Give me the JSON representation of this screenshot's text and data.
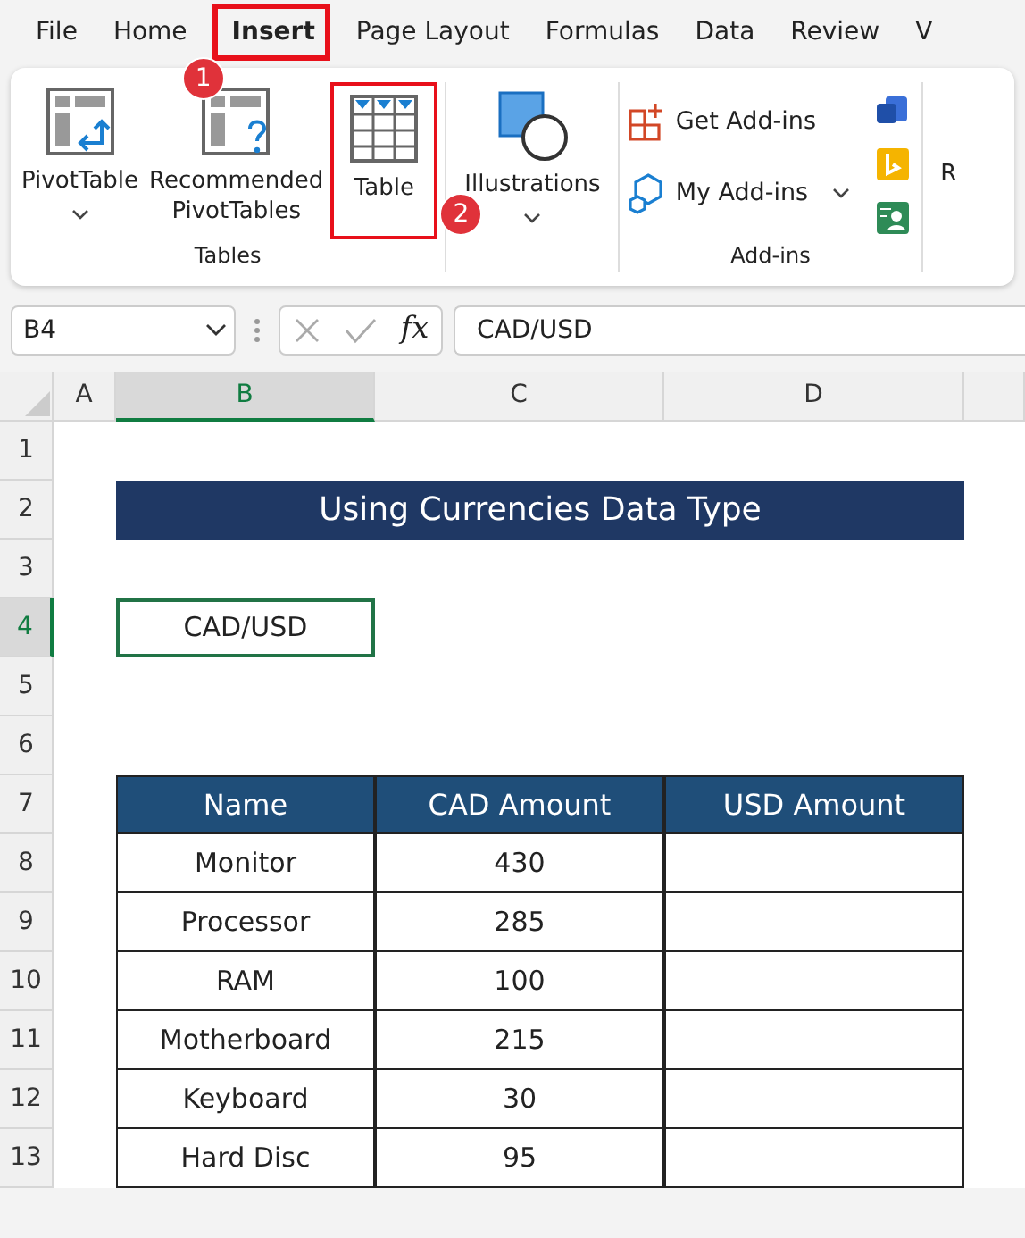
{
  "ribbon_tabs": [
    {
      "label": "File",
      "selected": false
    },
    {
      "label": "Home",
      "selected": false
    },
    {
      "label": "Insert",
      "selected": true,
      "step": "1"
    },
    {
      "label": "Page Layout",
      "selected": false
    },
    {
      "label": "Formulas",
      "selected": false
    },
    {
      "label": "Data",
      "selected": false
    },
    {
      "label": "Review",
      "selected": false
    },
    {
      "label": "V",
      "selected": false
    }
  ],
  "ribbon_groups": [
    {
      "label": "Tables",
      "items": [
        {
          "kind": "pivot",
          "label": "PivotTable",
          "dropdown": true
        },
        {
          "kind": "recommended",
          "label": "Recommended PivotTables"
        },
        {
          "kind": "table",
          "label": "Table",
          "step": "2"
        }
      ]
    },
    {
      "items": [
        {
          "kind": "shapes",
          "label": "Illustrations",
          "dropdown": true
        }
      ]
    },
    {
      "label": "Add-ins",
      "items": [
        {
          "kind": "get-addins",
          "label": "Get Add-ins"
        },
        {
          "kind": "my-addins",
          "label": "My Add-ins",
          "dropdown": true
        }
      ]
    },
    {
      "items": [
        {
          "kind": "partial",
          "label": "R"
        }
      ]
    }
  ],
  "formula_bar": {
    "name_box": "B4",
    "function_label": "fx",
    "formula": "CAD/USD"
  },
  "sheet": {
    "columns": [
      {
        "label": "A",
        "selected": false
      },
      {
        "label": "B",
        "selected": true
      },
      {
        "label": "C",
        "selected": false
      },
      {
        "label": "D",
        "selected": false
      }
    ],
    "rows": [
      {
        "label": "1",
        "selected": false
      },
      {
        "label": "2",
        "selected": false
      },
      {
        "label": "3",
        "selected": false
      },
      {
        "label": "4",
        "selected": true
      },
      {
        "label": "5",
        "selected": false
      },
      {
        "label": "6",
        "selected": false
      },
      {
        "label": "7",
        "selected": false
      },
      {
        "label": "8",
        "selected": false
      },
      {
        "label": "9",
        "selected": false
      },
      {
        "label": "10",
        "selected": false
      },
      {
        "label": "11",
        "selected": false
      },
      {
        "label": "12",
        "selected": false
      },
      {
        "label": "13",
        "selected": false
      }
    ],
    "title": "Using Currencies Data Type",
    "selected_cell": "CAD/USD",
    "table": {
      "columns": [
        "Name",
        "CAD Amount",
        "USD Amount"
      ],
      "rows": [
        [
          "Monitor",
          "430",
          ""
        ],
        [
          "Processor",
          "285",
          ""
        ],
        [
          "RAM",
          "100",
          ""
        ],
        [
          "Motherboard",
          "215",
          ""
        ],
        [
          "Keyboard",
          "30",
          ""
        ],
        [
          "Hard Disc",
          "95",
          ""
        ]
      ]
    }
  }
}
